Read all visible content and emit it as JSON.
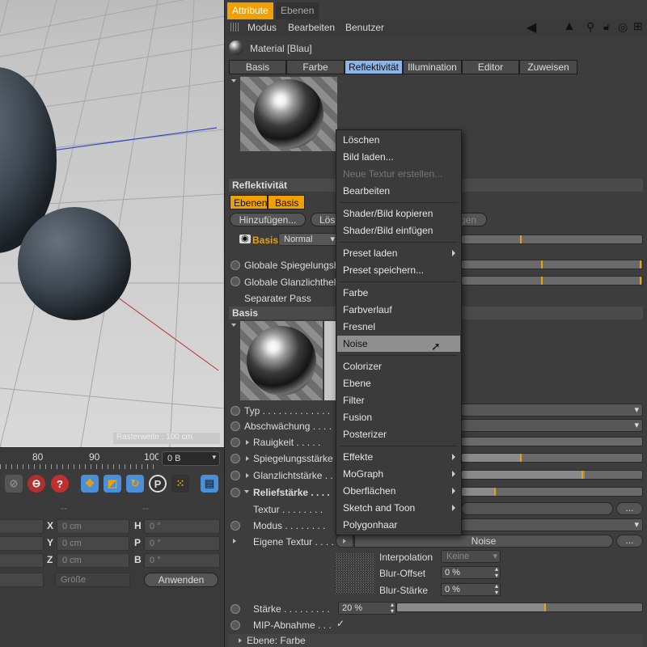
{
  "viewport": {
    "grid_label": "Rasterweite : 100 cm"
  },
  "timeline": {
    "ticks": [
      "80",
      "90",
      "100"
    ],
    "frame_value": "0 B"
  },
  "coords": {
    "header_dashes": [
      "--",
      "--"
    ],
    "rows": [
      {
        "pos_label": "X",
        "pos_value": "0 cm",
        "rot_label": "H",
        "rot_value": "0 °"
      },
      {
        "pos_label": "Y",
        "pos_value": "0 cm",
        "rot_label": "P",
        "rot_value": "0 °"
      },
      {
        "pos_label": "Z",
        "pos_value": "0 cm",
        "rot_label": "B",
        "rot_value": "0 °"
      }
    ],
    "size_dropdown": "Größe",
    "apply_button": "Anwenden"
  },
  "am": {
    "tabs": [
      "Attribute",
      "Ebenen"
    ],
    "menu": [
      "Modus",
      "Bearbeiten",
      "Benutzer"
    ],
    "material_title": "Material [Blau]",
    "subtabs": [
      "Basis",
      "Farbe",
      "Reflektivität",
      "Illumination",
      "Editor",
      "Zuweisen"
    ],
    "reflectivity_header": "Reflektivität",
    "layer_tabs": [
      "Ebenen",
      "Basis"
    ],
    "add_button": "Hinzufügen...",
    "remove_button": "Lös",
    "hidden_button": "gen",
    "layer_name": "Basis",
    "layer_mode": "Normal",
    "global_spec": "Globale Spiegelungsh",
    "global_gloss": "Globale Glanzlichthel",
    "separate_pass": "Separater Pass",
    "basis_header": "Basis",
    "typ_label": "Typ . . . . . . . . . . . . .",
    "attenuation_label": "Abschwächung . . . . .",
    "roughness_label": "Rauigkeit . . . . .",
    "spec_strength_label": "Spiegelungsstärke",
    "gloss_strength_label": "Glanzlichtstärke . .",
    "relief_label": "Reliefstärke . . . .",
    "texture_label": "Textur . . . . . . . .",
    "mode_label": "Modus . . . . . . . .",
    "own_texture_label": "Eigene Textur . . . .",
    "noise_name": "Noise",
    "more_button": "...",
    "interpolation_label": "Interpolation",
    "interpolation_value": "Keine",
    "blur_offset_label": "Blur-Offset",
    "blur_offset_value": "0 %",
    "blur_strength_label": "Blur-Stärke",
    "blur_strength_value": "0 %",
    "strength_label": "Stärke . . . . . . . . .",
    "strength_value": "20 %",
    "mip_label": "MIP-Abnahme . . .",
    "mip_check": "✓",
    "footer": "Ebene: Farbe",
    "values": {
      "spec_strength_fraction": 0.33,
      "gloss_strength_fraction": 0.68,
      "relief_fraction": 0.18,
      "strength_fraction": 0.6
    }
  },
  "context_menu": {
    "items": [
      "Löschen",
      "Bild laden...",
      "Neue Textur erstellen...",
      "Bearbeiten",
      "Shader/Bild kopieren",
      "Shader/Bild einfügen",
      "Preset laden",
      "Preset speichern...",
      "Farbe",
      "Farbverlauf",
      "Fresnel",
      "Noise",
      "Colorizer",
      "Ebene",
      "Filter",
      "Fusion",
      "Posterizer",
      "Effekte",
      "MoGraph",
      "Oberflächen",
      "Sketch and Toon",
      "Polygonhaar"
    ]
  },
  "colors": {
    "accent": "#f0a000",
    "active_tab": "#8bb4e8",
    "panel": "#3d3d3d",
    "highlight": "#8f8f8f"
  }
}
